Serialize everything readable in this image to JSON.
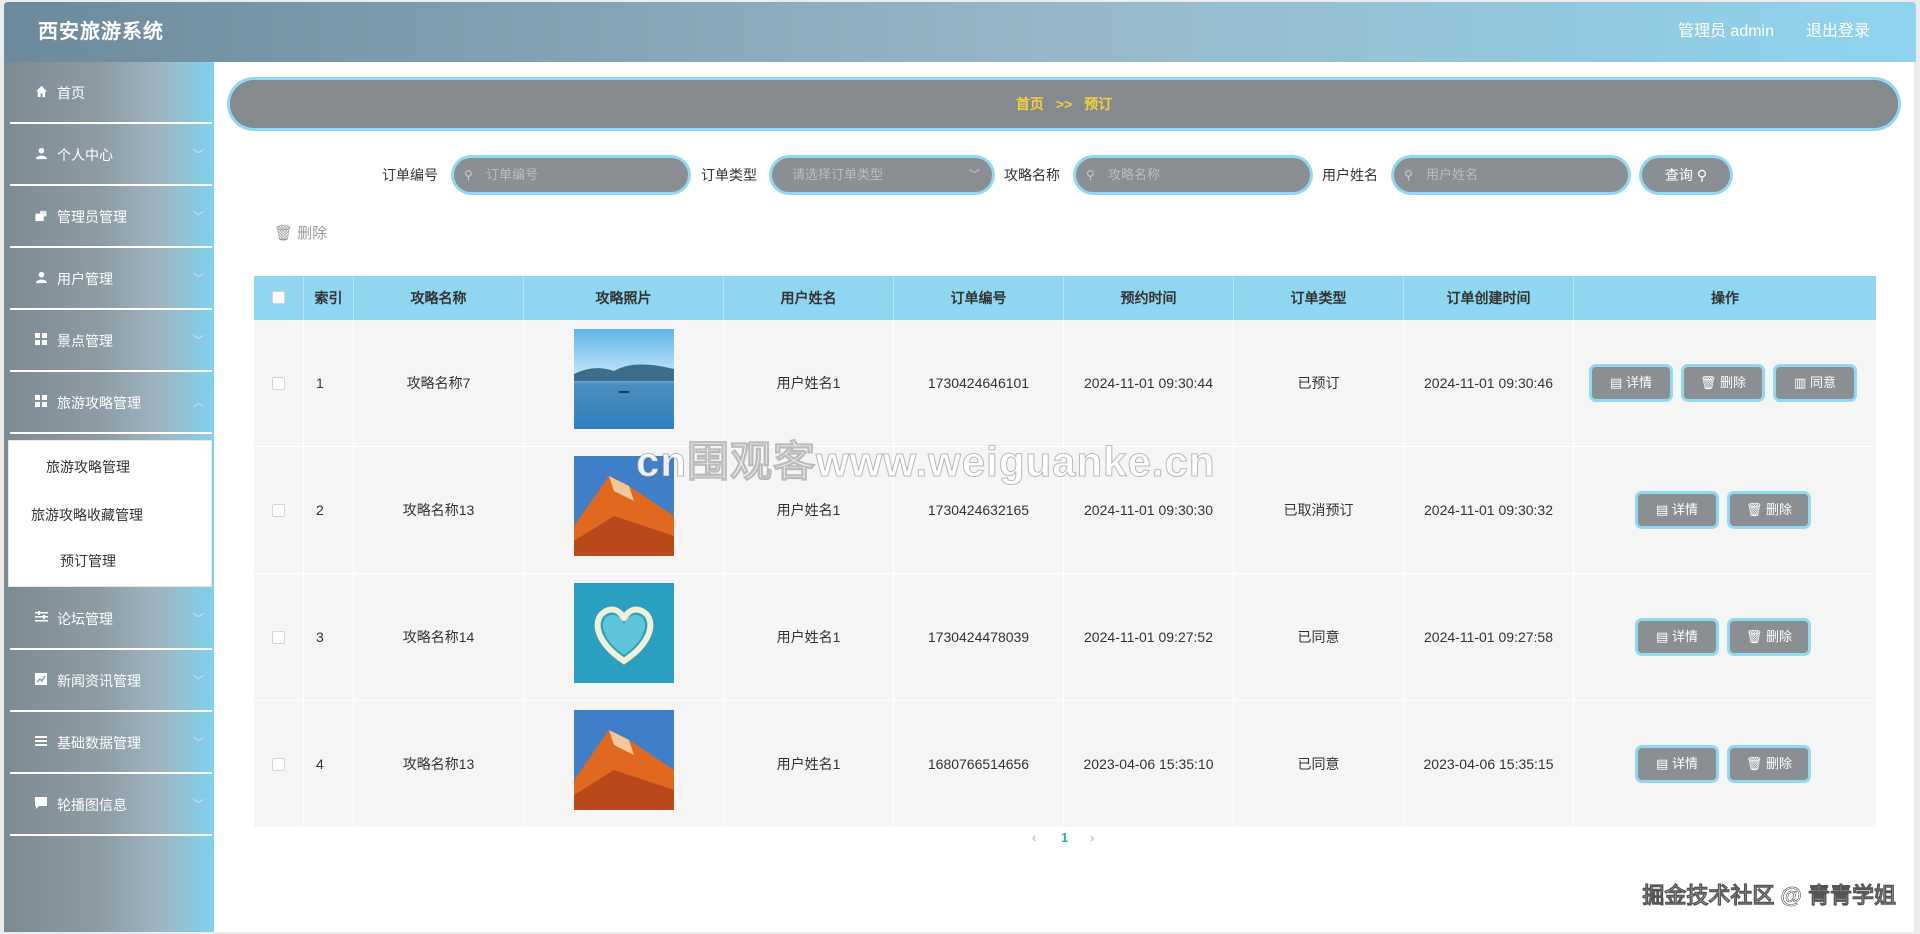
{
  "header": {
    "title": "西安旅游系统",
    "admin": "管理员 admin",
    "logout": "退出登录"
  },
  "sidebar": {
    "items": [
      {
        "label": "首页",
        "icon": "home-icon"
      },
      {
        "label": "个人中心",
        "icon": "user-icon"
      },
      {
        "label": "管理员管理",
        "icon": "admin-icon"
      },
      {
        "label": "用户管理",
        "icon": "user-icon"
      },
      {
        "label": "景点管理",
        "icon": "grid-icon"
      },
      {
        "label": "旅游攻略管理",
        "icon": "grid-icon"
      },
      {
        "label": "论坛管理",
        "icon": "sliders-icon"
      },
      {
        "label": "新闻资讯管理",
        "icon": "chart-icon"
      },
      {
        "label": "基础数据管理",
        "icon": "list-icon"
      },
      {
        "label": "轮播图信息",
        "icon": "message-icon"
      }
    ],
    "submenu": [
      "旅游攻略管理",
      "旅游攻略收藏管理",
      "预订管理"
    ]
  },
  "breadcrumb": {
    "home": "首页",
    "sep": ">>",
    "current": "预订"
  },
  "search": {
    "order_no_label": "订单编号",
    "order_no_placeholder": "订单编号",
    "order_type_label": "订单类型",
    "order_type_placeholder": "请选择订单类型",
    "guide_name_label": "攻略名称",
    "guide_name_placeholder": "攻略名称",
    "user_name_label": "用户姓名",
    "user_name_placeholder": "用户姓名",
    "query_label": "查询"
  },
  "toolbar": {
    "delete_label": "删除"
  },
  "table": {
    "headers": [
      "索引",
      "攻略名称",
      "攻略照片",
      "用户姓名",
      "订单编号",
      "预约时间",
      "订单类型",
      "订单创建时间",
      "操作"
    ],
    "rows": [
      {
        "index": "1",
        "name": "攻略名称7",
        "photo": "lake",
        "user": "用户姓名1",
        "order_no": "1730424646101",
        "time": "2024-11-01 09:30:44",
        "type": "已预订",
        "created": "2024-11-01 09:30:46",
        "actions": [
          "详情",
          "删除",
          "同意"
        ]
      },
      {
        "index": "2",
        "name": "攻略名称13",
        "photo": "mountain",
        "user": "用户姓名1",
        "order_no": "1730424632165",
        "time": "2024-11-01 09:30:30",
        "type": "已取消预订",
        "created": "2024-11-01 09:30:32",
        "actions": [
          "详情",
          "删除"
        ]
      },
      {
        "index": "3",
        "name": "攻略名称14",
        "photo": "heart-island",
        "user": "用户姓名1",
        "order_no": "1730424478039",
        "time": "2024-11-01 09:27:52",
        "type": "已同意",
        "created": "2024-11-01 09:27:58",
        "actions": [
          "详情",
          "删除"
        ]
      },
      {
        "index": "4",
        "name": "攻略名称13",
        "photo": "mountain",
        "user": "用户姓名1",
        "order_no": "1680766514656",
        "time": "2023-04-06 15:35:10",
        "type": "已同意",
        "created": "2023-04-06 15:35:15",
        "actions": [
          "详情",
          "删除"
        ]
      }
    ]
  },
  "pagination": {
    "prev": "‹",
    "page": "1",
    "next": "›"
  },
  "watermark": "cn围观客www.weiguanke.cn",
  "credit": "掘金技术社区 @ 青青学姐",
  "colors": {
    "accent": "#91d8f2",
    "button": "#8a8f93",
    "breadcrumb_text": "#f4d03f"
  }
}
